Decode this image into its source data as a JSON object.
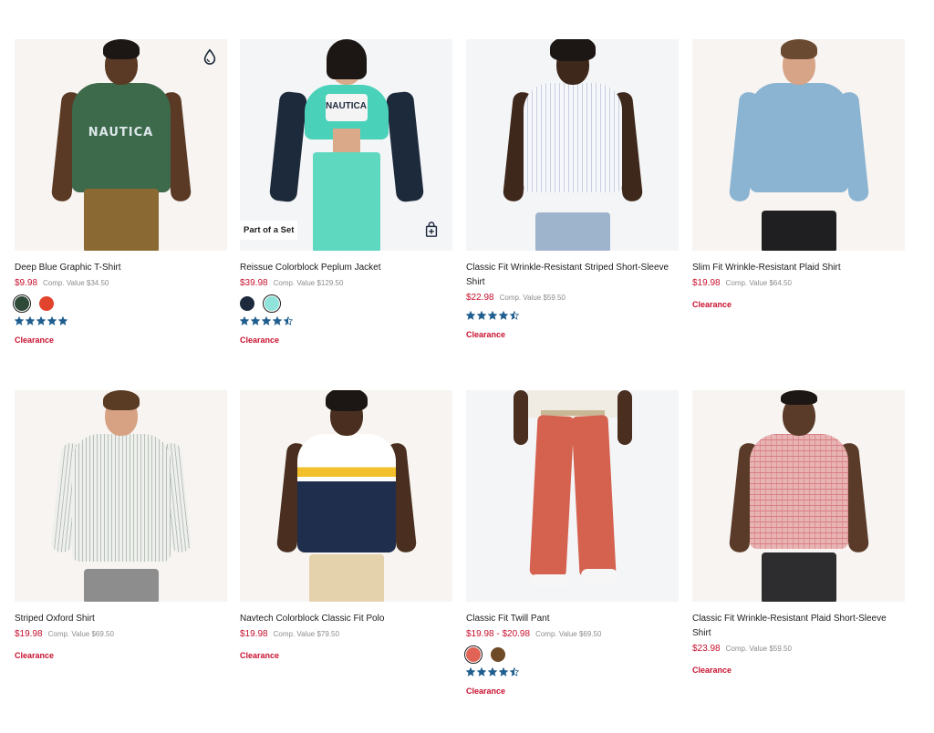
{
  "products": [
    {
      "title": "Deep Blue Graphic T-Shirt",
      "price": "$9.98",
      "comp": "Comp. Value $34.50",
      "swatches": [
        "#2f4a38",
        "#e2432c"
      ],
      "selected_swatch": 0,
      "rating": 5,
      "badge": "Clearance",
      "corner_icon": "water-drop-icon",
      "shirt_text": "NAUTICA",
      "shirt_color": "#3d6a4a",
      "pants_color": "#8a6a32",
      "skin": "#5a3a24"
    },
    {
      "title": "Reissue Colorblock Peplum Jacket",
      "price": "$39.98",
      "comp": "Comp. Value $129.50",
      "swatches": [
        "#1d2a3c",
        "#8fe3da"
      ],
      "selected_swatch": 1,
      "rating": 4.5,
      "badge": "Clearance",
      "set_label": "Part of a Set",
      "corner_icon": "shopping-bag-plus-icon",
      "shirt_text": "NAUTICA",
      "shirt_color": "#49d1b9",
      "pants_color": "#5fd8c0",
      "skin": "#d9a989"
    },
    {
      "title": "Classic Fit Wrinkle-Resistant Striped Short-Sleeve Shirt",
      "price": "$22.98",
      "comp": "Comp. Value $59.50",
      "rating": 4.5,
      "badge": "Clearance",
      "shirt_color": "#eceff5",
      "pants_color": "#9eb3cc",
      "skin": "#3e281b"
    },
    {
      "title": "Slim Fit Wrinkle-Resistant Plaid Shirt",
      "price": "$19.98",
      "comp": "Comp. Value $64.50",
      "badge": "Clearance",
      "shirt_color": "#8ab4d2",
      "pants_color": "#1f1f22",
      "skin": "#d8a487"
    },
    {
      "title": "Striped Oxford Shirt",
      "price": "$19.98",
      "comp": "Comp. Value $69.50",
      "badge": "Clearance",
      "shirt_color": "#dfe3e0",
      "pants_color": "#8d8d8e",
      "skin": "#d7a284"
    },
    {
      "title": "Navtech Colorblock Classic Fit Polo",
      "price": "$19.98",
      "comp": "Comp. Value $79.50",
      "badge": "Clearance",
      "shirt_color": "#1e2e4c",
      "pants_color": "#e4d2ad",
      "skin": "#4a2f20"
    },
    {
      "title": "Classic Fit Twill Pant",
      "price": "$19.98 - $20.98",
      "comp": "Comp. Value $69.50",
      "swatches": [
        "#e06355",
        "#6e4a26"
      ],
      "selected_swatch": 0,
      "rating": 4.5,
      "badge": "Clearance",
      "shirt_color": "#f0ece4",
      "pants_color": "#d5614f",
      "skin": "#4a2f20"
    },
    {
      "title": "Classic Fit Wrinkle-Resistant Plaid Short-Sleeve Shirt",
      "price": "$23.98",
      "comp": "Comp. Value $59.50",
      "badge": "Clearance",
      "shirt_color": "#f0c8c8",
      "pants_color": "#2d2d30",
      "skin": "#5a3a28"
    }
  ],
  "colors": {
    "price_red": "#c8102e",
    "star_blue": "#1f5e8e"
  }
}
